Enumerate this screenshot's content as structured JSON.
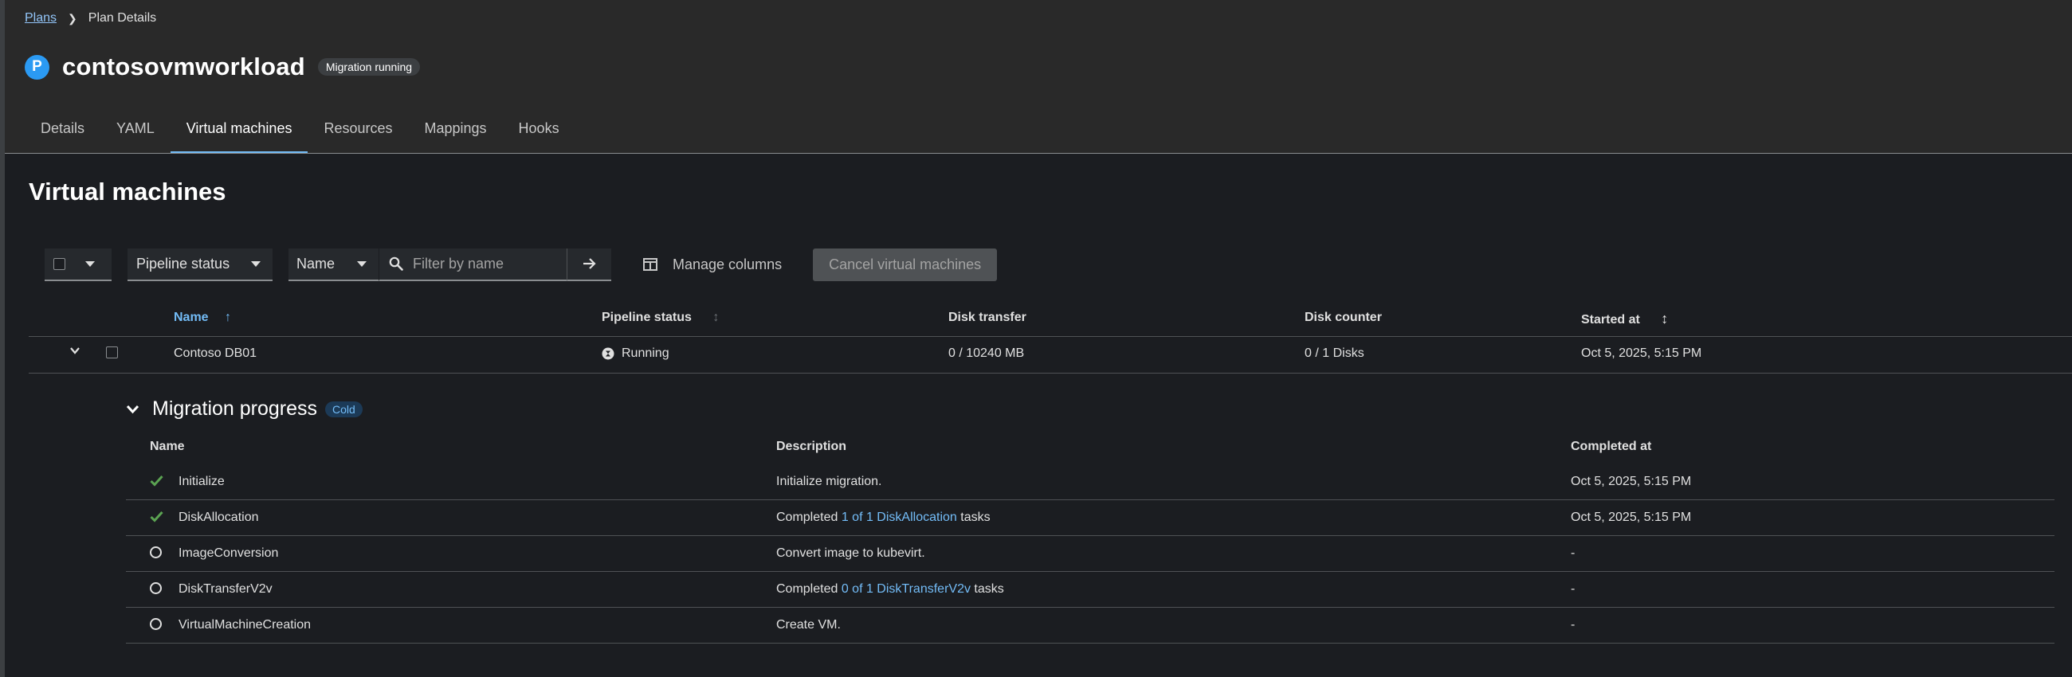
{
  "breadcrumb": {
    "root": "Plans",
    "current": "Plan Details"
  },
  "plan": {
    "badge_letter": "P",
    "name": "contosovmworkload",
    "status": "Migration running"
  },
  "tabs": [
    "Details",
    "YAML",
    "Virtual machines",
    "Resources",
    "Mappings",
    "Hooks"
  ],
  "active_tab": "Virtual machines",
  "section_title": "Virtual machines",
  "toolbar": {
    "pipeline_filter": "Pipeline status",
    "attribute": "Name",
    "search_placeholder": "Filter by name",
    "manage_columns": "Manage columns",
    "cancel_vms": "Cancel virtual machines"
  },
  "table": {
    "columns": [
      "Name",
      "Pipeline status",
      "Disk transfer",
      "Disk counter",
      "Started at"
    ],
    "rows": [
      {
        "name": "Contoso DB01",
        "pipeline_status": "Running",
        "disk_transfer": "0 / 10240 MB",
        "disk_counter": "0 / 1 Disks",
        "started_at": "Oct 5, 2025, 5:15 PM"
      }
    ]
  },
  "migration_progress": {
    "title": "Migration progress",
    "badge": "Cold",
    "columns": [
      "Name",
      "Description",
      "Completed at"
    ],
    "steps": [
      {
        "name": "Initialize",
        "status": "done",
        "desc_pre": "Initialize migration.",
        "link": "",
        "desc_post": "",
        "completed_at": "Oct 5, 2025, 5:15 PM"
      },
      {
        "name": "DiskAllocation",
        "status": "done",
        "desc_pre": "Completed",
        "link": "1 of 1 DiskAllocation",
        "desc_post": "tasks",
        "completed_at": "Oct 5, 2025, 5:15 PM"
      },
      {
        "name": "ImageConversion",
        "status": "pending",
        "desc_pre": "Convert image to kubevirt.",
        "link": "",
        "desc_post": "",
        "completed_at": "-"
      },
      {
        "name": "DiskTransferV2v",
        "status": "pending",
        "desc_pre": "Completed",
        "link": "0 of 1 DiskTransferV2v",
        "desc_post": "tasks",
        "completed_at": "-"
      },
      {
        "name": "VirtualMachineCreation",
        "status": "pending",
        "desc_pre": "Create VM.",
        "link": "",
        "desc_post": "",
        "completed_at": "-"
      }
    ]
  },
  "colors": {
    "accent": "#73bcf7",
    "success": "#5ba352",
    "badge_blue": "#2b9af3"
  }
}
